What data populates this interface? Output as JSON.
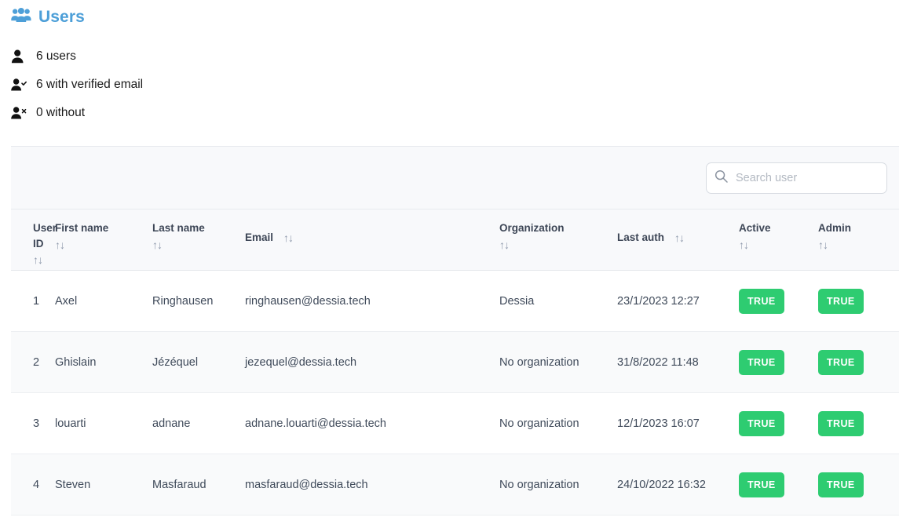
{
  "header": {
    "title": "Users",
    "icon": "users-group-icon",
    "title_color": "#4d9fd8"
  },
  "stats": [
    {
      "icon": "person-icon",
      "text": "6 users"
    },
    {
      "icon": "person-check-icon",
      "text": "6 with verified email"
    },
    {
      "icon": "person-x-icon",
      "text": "0 without"
    }
  ],
  "toolbar": {
    "search_placeholder": "Search user",
    "search_value": "",
    "search_icon": "search-icon"
  },
  "table": {
    "sort_glyph": "↑↓",
    "columns": [
      {
        "label": "User ID",
        "sort_inline": false
      },
      {
        "label": "First name",
        "sort_inline": false
      },
      {
        "label": "Last name",
        "sort_inline": false
      },
      {
        "label": "Email",
        "sort_inline": true
      },
      {
        "label": "Organization",
        "sort_inline": false
      },
      {
        "label": "Last auth",
        "sort_inline": true
      },
      {
        "label": "Active",
        "sort_inline": false
      },
      {
        "label": "Admin",
        "sort_inline": false
      }
    ],
    "rows": [
      {
        "id": "1",
        "first_name": "Axel",
        "last_name": "Ringhausen",
        "email": "ringhausen@dessia.tech",
        "organization": "Dessia",
        "last_auth": "23/1/2023 12:27",
        "active": "TRUE",
        "admin": "TRUE"
      },
      {
        "id": "2",
        "first_name": "Ghislain",
        "last_name": "Jézéquel",
        "email": "jezequel@dessia.tech",
        "organization": "No organization",
        "last_auth": "31/8/2022 11:48",
        "active": "TRUE",
        "admin": "TRUE"
      },
      {
        "id": "3",
        "first_name": "louarti",
        "last_name": "adnane",
        "email": "adnane.louarti@dessia.tech",
        "organization": "No organization",
        "last_auth": "12/1/2023 16:07",
        "active": "TRUE",
        "admin": "TRUE"
      },
      {
        "id": "4",
        "first_name": "Steven",
        "last_name": "Masfaraud",
        "email": "masfaraud@dessia.tech",
        "organization": "No organization",
        "last_auth": "24/10/2022 16:32",
        "active": "TRUE",
        "admin": "TRUE"
      }
    ]
  },
  "colors": {
    "accent_blue": "#4d9fd8",
    "badge_green": "#2ecc71",
    "text_dark": "#3f4a5a",
    "header_text": "#3d4656",
    "row_alt": "#f9fafb",
    "panel_bg": "#f8f9fb"
  }
}
